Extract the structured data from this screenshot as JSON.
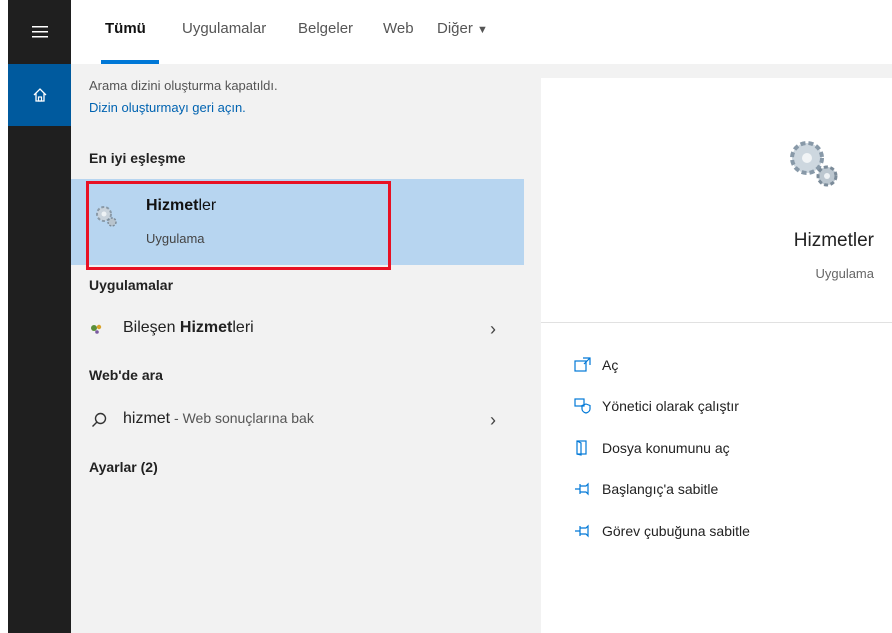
{
  "tabs": [
    {
      "label": "Tümü",
      "active": true
    },
    {
      "label": "Uygulamalar",
      "active": false
    },
    {
      "label": "Belgeler",
      "active": false
    },
    {
      "label": "Web",
      "active": false
    },
    {
      "label": "Diğer",
      "active": false
    }
  ],
  "notice": {
    "text": "Arama dizini oluşturma kapatıldı.",
    "link": "Dizin oluşturmayı geri açın."
  },
  "best_match": {
    "section": "En iyi eşleşme",
    "title_bold": "Hizmet",
    "title_rest": "ler",
    "subtitle": "Uygulama"
  },
  "apps": {
    "section": "Uygulamalar",
    "item_prefix": "Bileşen ",
    "item_bold": "Hizmet",
    "item_suffix": "leri"
  },
  "web": {
    "section": "Web'de ara",
    "query": "hizmet",
    "suffix": " - Web sonuçlarına bak"
  },
  "settings": {
    "section": "Ayarlar (2)"
  },
  "preview": {
    "title": "Hizmetler",
    "subtitle": "Uygulama",
    "actions": [
      {
        "label": "Aç",
        "icon": "open-icon"
      },
      {
        "label": "Yönetici olarak çalıştır",
        "icon": "shield-icon"
      },
      {
        "label": "Dosya konumunu aç",
        "icon": "file-location-icon"
      },
      {
        "label": "Başlangıç'a sabitle",
        "icon": "pin-icon"
      },
      {
        "label": "Görev çubuğuna sabitle",
        "icon": "pin-icon"
      }
    ]
  },
  "colors": {
    "accent": "#0078d7",
    "selection": "#b7d5f0",
    "highlight_box": "#e81123"
  }
}
